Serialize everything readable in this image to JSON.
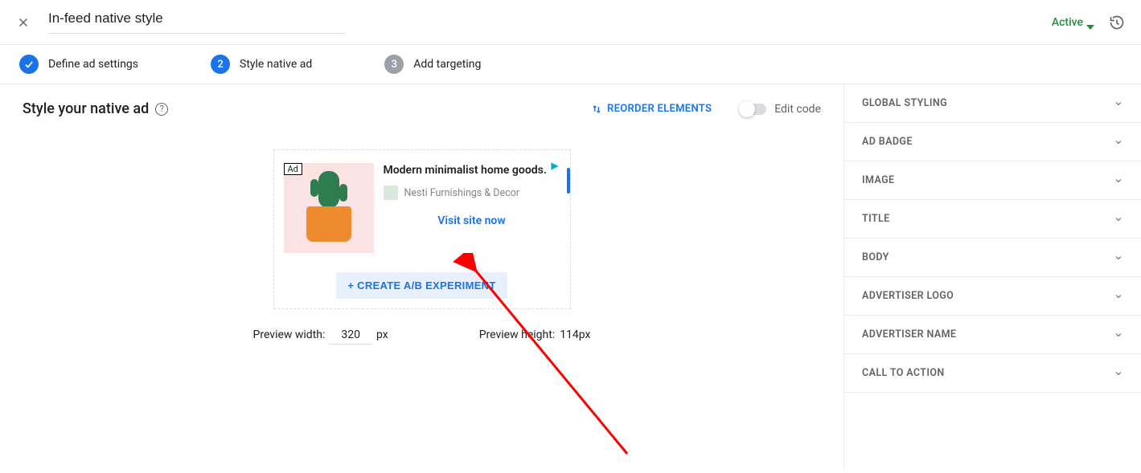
{
  "header": {
    "title": "In-feed native style",
    "status_label": "Active"
  },
  "stepper": {
    "step1": {
      "label": "Define ad settings"
    },
    "step2": {
      "num": "2",
      "label": "Style native ad"
    },
    "step3": {
      "num": "3",
      "label": "Add targeting"
    }
  },
  "page": {
    "heading": "Style your native ad",
    "reorder_label": "REORDER ELEMENTS",
    "editcode_label": "Edit code"
  },
  "ad": {
    "badge": "Ad",
    "headline": "Modern minimalist home goods.",
    "advertiser": "Nesti Furnishings & Decor",
    "cta": "Visit site now"
  },
  "experiment_button": "+ CREATE A/B EXPERIMENT",
  "dims": {
    "width_label": "Preview width:",
    "width_value": "320",
    "width_unit": "px",
    "height_label": "Preview height:",
    "height_value": "114px"
  },
  "panel": {
    "items": [
      "GLOBAL STYLING",
      "AD BADGE",
      "IMAGE",
      "TITLE",
      "BODY",
      "ADVERTISER LOGO",
      "ADVERTISER NAME",
      "CALL TO ACTION"
    ]
  }
}
